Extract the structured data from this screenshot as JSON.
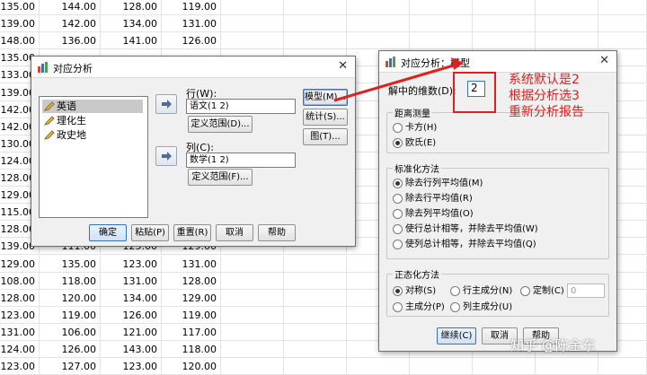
{
  "sheet": {
    "rows": [
      [
        "135.00",
        "144.00",
        "128.00",
        "119.00"
      ],
      [
        "139.00",
        "142.00",
        "134.00",
        "131.00"
      ],
      [
        "148.00",
        "136.00",
        "141.00",
        "126.00"
      ],
      [
        "135.00",
        "",
        "",
        ""
      ],
      [
        "133.00",
        "",
        "",
        ""
      ],
      [
        "139.00",
        "",
        "",
        ""
      ],
      [
        "142.00",
        "",
        "",
        ""
      ],
      [
        "142.00",
        "",
        "",
        ""
      ],
      [
        "130.00",
        "",
        "",
        ""
      ],
      [
        "124.00",
        "",
        "",
        ""
      ],
      [
        "128.00",
        "",
        "",
        ""
      ],
      [
        "129.00",
        "",
        "",
        ""
      ],
      [
        "115.00",
        "",
        "",
        ""
      ],
      [
        "128.00",
        "",
        "",
        ""
      ],
      [
        "139.00",
        "111.00",
        "125.00",
        "129.00"
      ],
      [
        "129.00",
        "135.00",
        "123.00",
        "131.00"
      ],
      [
        "108.00",
        "118.00",
        "131.00",
        "128.00"
      ],
      [
        "128.00",
        "120.00",
        "134.00",
        "129.00"
      ],
      [
        "123.00",
        "119.00",
        "126.00",
        "119.00"
      ],
      [
        "131.00",
        "106.00",
        "121.00",
        "117.00"
      ],
      [
        "124.00",
        "126.00",
        "143.00",
        "118.00"
      ],
      [
        "123.00",
        "127.00",
        "123.00",
        "120.00"
      ]
    ]
  },
  "main_dialog": {
    "title": "对应分析",
    "close": "✕",
    "variables": [
      "英语",
      "理化生",
      "政史地"
    ],
    "row_label": "行(W):",
    "row_value": "语文(1 2)",
    "row_define": "定义范围(D)...",
    "col_label": "列(C):",
    "col_value": "数学(1 2)",
    "col_define": "定义范围(F)...",
    "model_btn": "模型(M)...",
    "stats_btn": "统计(S)...",
    "plot_btn": "图(T)...",
    "ok": "确定",
    "paste": "粘贴(P)",
    "reset": "重置(R)",
    "cancel": "取消",
    "help": "帮助"
  },
  "model_dialog": {
    "title": "对应分析：模型",
    "close": "✕",
    "dims_label": "解中的维数(D):",
    "dims_value": "2",
    "distance_title": "距离测量",
    "distance_options": [
      "卡方(H)",
      "欧氏(E)"
    ],
    "standardization_title": "标准化方法",
    "standardization_options": [
      "除去行列平均值(M)",
      "除去行平均值(R)",
      "除去列平均值(O)",
      "使行总计相等，并除去平均值(W)",
      "使列总计相等，并除去平均值(Q)"
    ],
    "normalization_title": "正态化方法",
    "norm_symmetric": "对称(S)",
    "norm_row_principal": "行主成分(N)",
    "norm_custom": "定制(C)",
    "norm_custom_value": "0",
    "norm_principal": "主成分(P)",
    "norm_col_principal": "列主成分(U)",
    "continue": "继续(C)",
    "cancel": "取消",
    "help": "帮助"
  },
  "annotation": {
    "lines": [
      "系统默认是2",
      "根据分析选3",
      "重新分析报告"
    ],
    "color": "#e02020"
  },
  "watermark": "知乎 @陈金东"
}
